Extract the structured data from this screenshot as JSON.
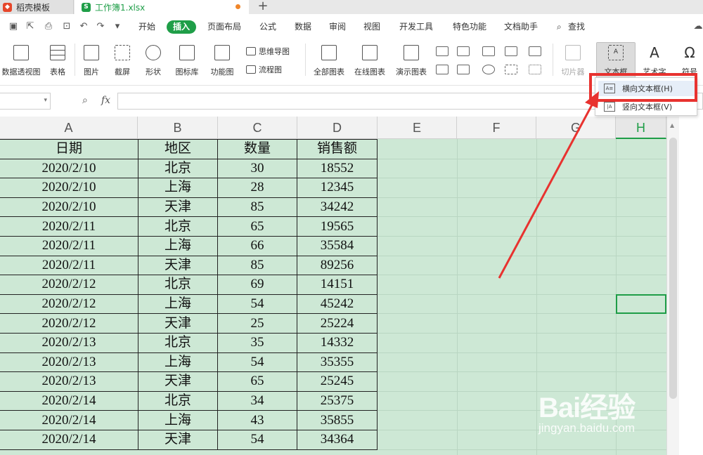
{
  "tabs": [
    {
      "label": "稻壳模板",
      "icon_color": "#e6472b"
    },
    {
      "label": "工作簿1.xlsx",
      "icon_color": "#1f9e48"
    }
  ],
  "menu": {
    "items": [
      "开始",
      "插入",
      "页面布局",
      "公式",
      "数据",
      "审阅",
      "视图",
      "开发工具",
      "特色功能",
      "文档助手",
      "查找"
    ],
    "active": "插入"
  },
  "ribbon": {
    "pivot": "数据透视图",
    "table": "表格",
    "picture": "图片",
    "screenshot": "截屏",
    "shapes": "形状",
    "icon_lib": "图标库",
    "func_chart": "功能图",
    "mindmap": "思维导图",
    "flowchart": "流程图",
    "all_charts": "全部图表",
    "online_charts": "在线图表",
    "demo_charts": "演示图表",
    "slicer": "切片器",
    "textbox": "文本框",
    "wordart": "艺术字",
    "symbol": "符号"
  },
  "dropdown": {
    "horizontal": "横向文本框(H)",
    "vertical": "竖向文本框(V)"
  },
  "formula": {
    "fx": "fx",
    "name_box": "",
    "content": ""
  },
  "columns": [
    "A",
    "B",
    "C",
    "D",
    "E",
    "F",
    "G",
    "H"
  ],
  "active_column": "H",
  "table": {
    "header": [
      "日期",
      "地区",
      "数量",
      "销售额"
    ],
    "rows": [
      [
        "2020/2/10",
        "北京",
        "30",
        "18552"
      ],
      [
        "2020/2/10",
        "上海",
        "28",
        "12345"
      ],
      [
        "2020/2/10",
        "天津",
        "85",
        "34242"
      ],
      [
        "2020/2/11",
        "北京",
        "65",
        "19565"
      ],
      [
        "2020/2/11",
        "上海",
        "66",
        "35584"
      ],
      [
        "2020/2/11",
        "天津",
        "85",
        "89256"
      ],
      [
        "2020/2/12",
        "北京",
        "69",
        "14151"
      ],
      [
        "2020/2/12",
        "上海",
        "54",
        "45242"
      ],
      [
        "2020/2/12",
        "天津",
        "25",
        "25224"
      ],
      [
        "2020/2/13",
        "北京",
        "35",
        "14332"
      ],
      [
        "2020/2/13",
        "上海",
        "54",
        "35355"
      ],
      [
        "2020/2/13",
        "天津",
        "65",
        "25245"
      ],
      [
        "2020/2/14",
        "北京",
        "34",
        "25375"
      ],
      [
        "2020/2/14",
        "上海",
        "43",
        "35855"
      ],
      [
        "2020/2/14",
        "天津",
        "54",
        "34364"
      ]
    ]
  },
  "watermark": {
    "brand": "Bai经验",
    "url": "jingyan.baidu.com"
  },
  "colors": {
    "accent": "#1f9e48",
    "sheet_bg": "#cde8d5",
    "highlight": "#e8322f"
  }
}
